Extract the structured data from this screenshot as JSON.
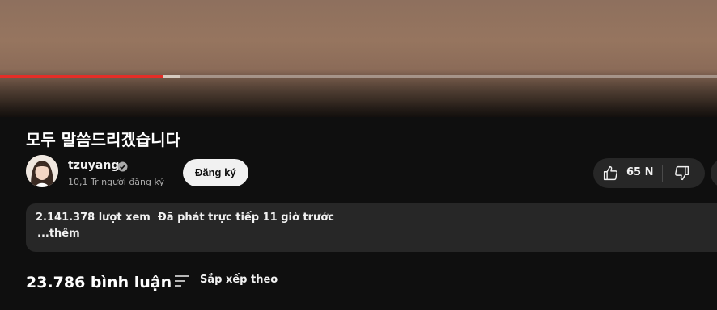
{
  "player": {
    "played_fraction": 0.227,
    "buffered_fraction": 0.25,
    "played_color": "#e52d27"
  },
  "video": {
    "title": "모두 말씀드리겠습니다"
  },
  "channel": {
    "name": "tzuyang",
    "verified_icon": "verified-check-icon",
    "subscribers": "10,1 Tr người đăng ký",
    "subscribe_label": "Đăng ký"
  },
  "actions": {
    "like_icon": "thumbs-up-icon",
    "like_count": "65 N",
    "dislike_icon": "thumbs-down-icon"
  },
  "description": {
    "meta": "2.141.378 lượt xem  Đã phát trực tiếp 11 giờ trước",
    "more_label": "...thêm"
  },
  "comments": {
    "count_label": "23.786 bình luận",
    "sort_icon": "sort-lines-icon",
    "sort_label": "Sắp xếp theo"
  }
}
